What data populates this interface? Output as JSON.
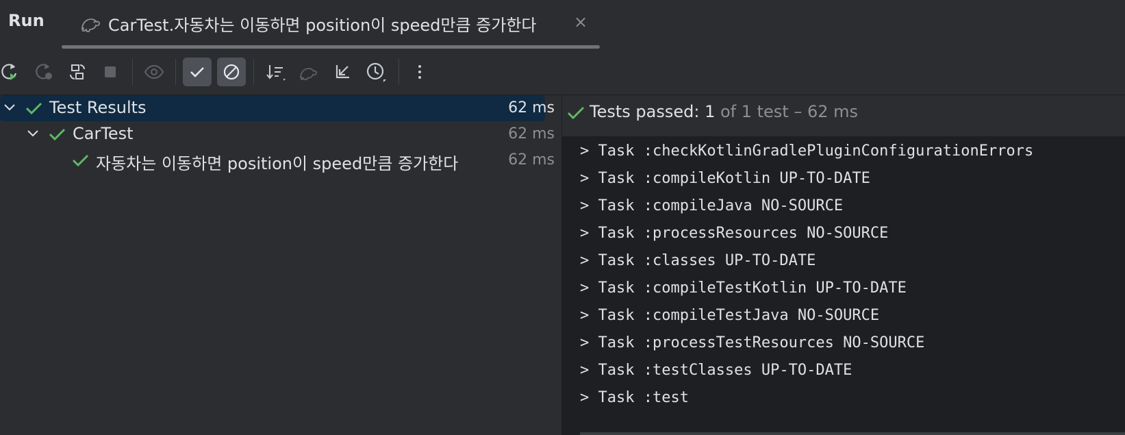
{
  "header": {
    "run_label": "Run",
    "tab_label": "CarTest.자동차는 이동하면 position이 speed만큼 증가한다",
    "close_glyph": "×"
  },
  "toolbar": {
    "icons": [
      "rerun-icon",
      "rerun-failed-icon",
      "toggle-auto-test-icon",
      "stop-icon",
      "show-ignored-icon",
      "show-passed-icon",
      "show-ignored-toggle-icon",
      "sort-icon",
      "import-tests-icon",
      "collapse-icon",
      "history-icon",
      "more-icon"
    ]
  },
  "tree": {
    "root": {
      "label": "Test Results",
      "duration": "62 ms"
    },
    "suite": {
      "label": "CarTest",
      "duration": "62 ms"
    },
    "test": {
      "label": "자동차는 이동하면 position이 speed만큼 증가한다",
      "duration": "62 ms"
    }
  },
  "status": {
    "prefix": "Tests passed: ",
    "count": "1",
    "suffix": " of 1 test – 62 ms"
  },
  "console": {
    "lines": [
      "> Task :checkKotlinGradlePluginConfigurationErrors",
      "> Task :compileKotlin UP-TO-DATE",
      "> Task :compileJava NO-SOURCE",
      "> Task :processResources NO-SOURCE",
      "> Task :classes UP-TO-DATE",
      "> Task :compileTestKotlin UP-TO-DATE",
      "> Task :compileTestJava NO-SOURCE",
      "> Task :processTestResources NO-SOURCE",
      "> Task :testClasses UP-TO-DATE",
      "> Task :test"
    ]
  },
  "colors": {
    "accent_green": "#5fb865",
    "background": "#2b2d30",
    "console_bg": "#1e1f22",
    "selection": "#0f2a42"
  }
}
